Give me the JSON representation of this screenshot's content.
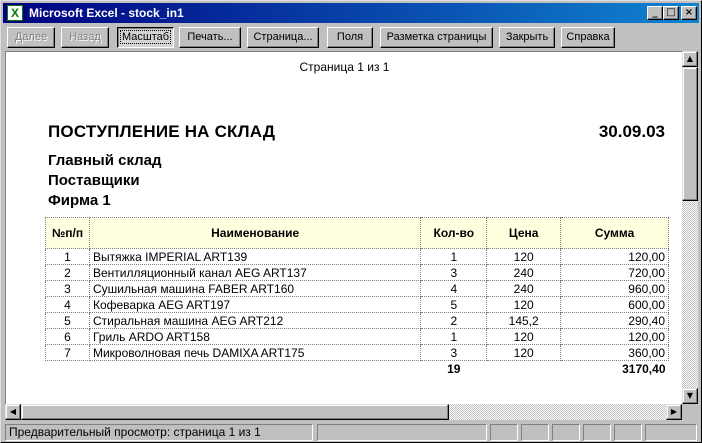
{
  "window": {
    "title": "Microsoft Excel - stock_in1",
    "icon": "excel-icon",
    "controls": {
      "minimize": "_",
      "maximize": "□",
      "close": "×"
    }
  },
  "toolbar": {
    "next": "Далее",
    "previous": "Назад",
    "zoom": "Масштаб",
    "print": "Печать...",
    "setup": "Страница...",
    "margins": "Поля",
    "page_break": "Разметка страницы",
    "close": "Закрыть",
    "help": "Справка"
  },
  "preview": {
    "page_info": "Страница 1 из 1",
    "title": "ПОСТУПЛЕНИЕ НА СКЛАД",
    "date": "30.09.03",
    "warehouse": "Главный склад",
    "suppliers": "Поставщики",
    "company": "Фирма 1",
    "table": {
      "headers": [
        "№п/п",
        "Наименование",
        "Кол-во",
        "Цена",
        "Сумма"
      ],
      "rows": [
        [
          "1",
          "Вытяжка IMPERIAL ART139",
          "1",
          "120",
          "120,00"
        ],
        [
          "2",
          "Вентилляционный канал AEG ART137",
          "3",
          "240",
          "720,00"
        ],
        [
          "3",
          "Сушильная машина FABER ART160",
          "4",
          "240",
          "960,00"
        ],
        [
          "4",
          "Кофеварка AEG ART197",
          "5",
          "120",
          "600,00"
        ],
        [
          "5",
          "Стиральная машина AEG ART212",
          "2",
          "145,2",
          "290,40"
        ],
        [
          "6",
          "Гриль ARDO ART158",
          "1",
          "120",
          "120,00"
        ],
        [
          "7",
          "Микроволновая печь DAMIXA ART175",
          "3",
          "120",
          "360,00"
        ]
      ],
      "total_qty": "19",
      "total_sum": "3170,40"
    }
  },
  "statusbar": {
    "text": "Предварительный просмотр: страница 1 из 1"
  },
  "colors": {
    "titlebar_start": "#000080",
    "titlebar_end": "#1084d0",
    "header_fill": "#ffffe0",
    "face": "#c0c0c0"
  }
}
